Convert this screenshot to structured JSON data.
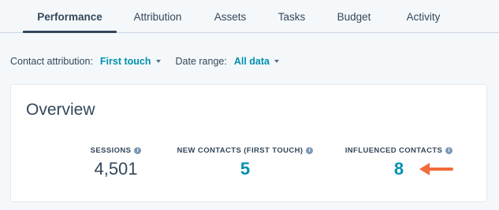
{
  "tabs": [
    "Performance",
    "Attribution",
    "Assets",
    "Tasks",
    "Budget",
    "Activity"
  ],
  "filters": {
    "attribution_label": "Contact attribution:",
    "attribution_value": "First touch",
    "date_label": "Date range:",
    "date_value": "All data"
  },
  "overview": {
    "title": "Overview",
    "metrics": [
      {
        "label": "SESSIONS",
        "value": "4,501"
      },
      {
        "label": "NEW CONTACTS (FIRST TOUCH)",
        "value": "5"
      },
      {
        "label": "INFLUENCED CONTACTS",
        "value": "8"
      }
    ]
  },
  "colors": {
    "accent_link": "#0091ae",
    "text": "#33475b",
    "annotation_arrow": "#f26b3a"
  },
  "icons": [
    "info-icon",
    "chevron-down-icon",
    "annotation-arrow-icon"
  ]
}
